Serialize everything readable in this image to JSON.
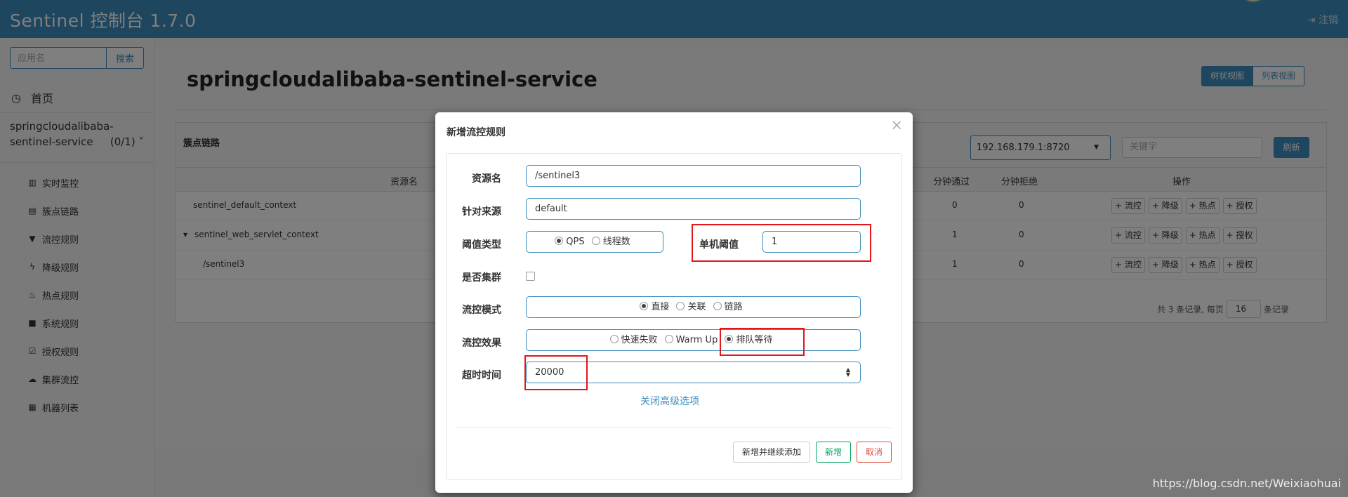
{
  "app": {
    "title": "Sentinel 控制台 1.7.0",
    "logout": "注销"
  },
  "sidebar": {
    "search_placeholder": "应用名",
    "search_button": "搜索",
    "home": "首页",
    "app_name_line1": "springcloudalibaba-",
    "app_name_line2": "sentinel-service",
    "app_count": "(0/1)",
    "items": [
      {
        "label": "实时监控",
        "icon": "bar-chart-icon"
      },
      {
        "label": "簇点链路",
        "icon": "list-icon"
      },
      {
        "label": "流控规则",
        "icon": "filter-icon"
      },
      {
        "label": "降级规则",
        "icon": "bolt-icon"
      },
      {
        "label": "热点规则",
        "icon": "fire-icon"
      },
      {
        "label": "系统规则",
        "icon": "lock-icon"
      },
      {
        "label": "授权规则",
        "icon": "check-icon"
      },
      {
        "label": "集群流控",
        "icon": "cloud-icon"
      },
      {
        "label": "机器列表",
        "icon": "grid-icon"
      }
    ]
  },
  "main": {
    "title": "springcloudalibaba-sentinel-service",
    "view_tree": "树状视图",
    "view_list": "列表视图",
    "panel_title": "簇点链路",
    "ip_selected": "192.168.179.1:8720",
    "keyword_placeholder": "关键字",
    "refresh": "刷新",
    "columns": {
      "resource": "资源名",
      "pass_qps": "分钟通过",
      "block_qps": "分钟拒绝",
      "ops": "操作"
    },
    "rows": [
      {
        "name": "sentinel_default_context",
        "pass": "0",
        "block": "0"
      },
      {
        "name": "sentinel_web_servlet_context",
        "pass": "1",
        "block": "0"
      },
      {
        "name": "/sentinel3",
        "pass": "1",
        "block": "0"
      }
    ],
    "op_buttons": [
      "+ 流控",
      "+ 降级",
      "+ 热点",
      "+ 授权"
    ],
    "pager_prefix": "共 3 条记录, 每页",
    "page_size": "16",
    "pager_suffix": "条记录"
  },
  "modal": {
    "title": "新增流控规则",
    "close": "×",
    "labels": {
      "resource": "资源名",
      "limit_app": "针对来源",
      "grade": "阈值类型",
      "count": "单机阈值",
      "cluster": "是否集群",
      "strategy": "流控模式",
      "behavior": "流控效果",
      "timeout": "超时时间"
    },
    "values": {
      "resource": "/sentinel3",
      "limit_app": "default",
      "count": "1",
      "timeout": "20000"
    },
    "grade_options": [
      "QPS",
      "线程数"
    ],
    "grade_selected": "QPS",
    "strategy_options": [
      "直接",
      "关联",
      "链路"
    ],
    "strategy_selected": "直接",
    "behavior_options": [
      "快速失败",
      "Warm Up",
      "排队等待"
    ],
    "behavior_selected": "排队等待",
    "cluster_checked": false,
    "advanced_link": "关闭高级选项",
    "btn_add_continue": "新增并继续添加",
    "btn_add": "新增",
    "btn_cancel": "取消"
  },
  "watermark": "https://blog.csdn.net/Weixiaohuai",
  "colors": {
    "primary": "#3c8dbc",
    "success": "#00a65a",
    "danger": "#dd4b39",
    "highlight": "#e3161b"
  }
}
